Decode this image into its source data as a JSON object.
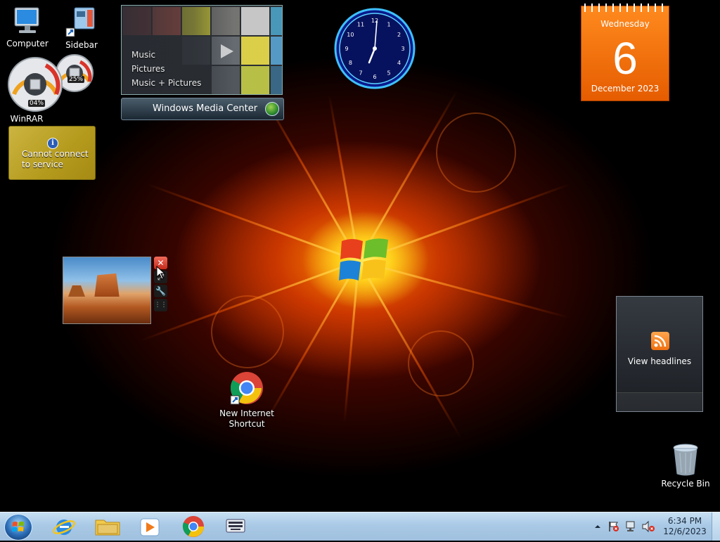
{
  "desktop": {
    "icons": [
      {
        "key": "computer",
        "label": "Computer"
      },
      {
        "key": "sidebar",
        "label": "Sidebar"
      },
      {
        "key": "winrar",
        "label": "WinRAR"
      },
      {
        "key": "chrome_shortcut",
        "label": "New Internet Shortcut"
      },
      {
        "key": "recycle_bin",
        "label": "Recycle Bin"
      }
    ]
  },
  "gadgets": {
    "media_center": {
      "menu": [
        "Music",
        "Pictures",
        "Music + Pictures"
      ],
      "title": "Windows Media Center"
    },
    "cpu_meter": {
      "cpu": "04%",
      "ram": "25%"
    },
    "weather": {
      "message_line1": "Cannot connect",
      "message_line2": "to service"
    },
    "calendar": {
      "weekday": "Wednesday",
      "day": "6",
      "month_year": "December 2023"
    },
    "clock": {
      "numbers": [
        "12",
        "1",
        "2",
        "3",
        "4",
        "5",
        "6",
        "7",
        "8",
        "9",
        "10",
        "11"
      ]
    },
    "feeds": {
      "label": "View headlines"
    }
  },
  "taskbar": {
    "pinned": [
      "start-orb",
      "internet-explorer",
      "windows-explorer",
      "media-player",
      "chrome",
      "on-screen-keyboard"
    ],
    "time": "6:34 PM",
    "date": "12/6/2023"
  }
}
